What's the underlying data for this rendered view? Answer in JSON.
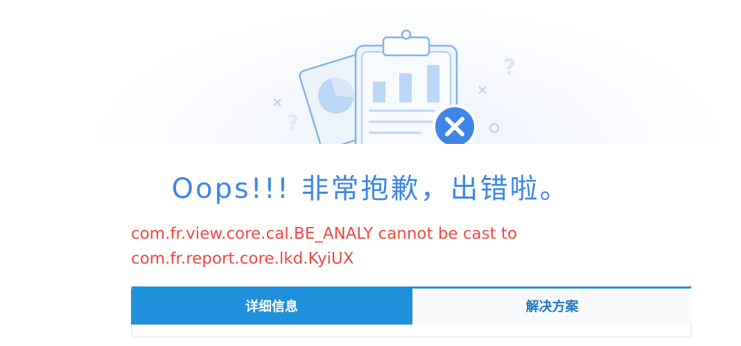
{
  "error": {
    "title": "Oops!!! 非常抱歉，出错啦。",
    "message_line1": "com.fr.view.core.cal.BE_ANALY cannot be cast to",
    "message_line2": "com.fr.report.core.lkd.KyiUX"
  },
  "tabs": [
    {
      "label": "详细信息",
      "active": true
    },
    {
      "label": "解决方案",
      "active": false
    }
  ],
  "illustration": {
    "icon": "clipboard-error-illustration",
    "badge_icon": "close-icon",
    "colors": {
      "outline": "#7fb3ec",
      "fill_light": "#eef4fc",
      "bar_fill": "#bcd6f7",
      "badge": "#3d86e6"
    }
  },
  "colors": {
    "title": "#3d86e6",
    "error_text": "#f0483e",
    "tab_active_bg": "#1f90db",
    "tab_inactive_text": "#1d78c5"
  }
}
